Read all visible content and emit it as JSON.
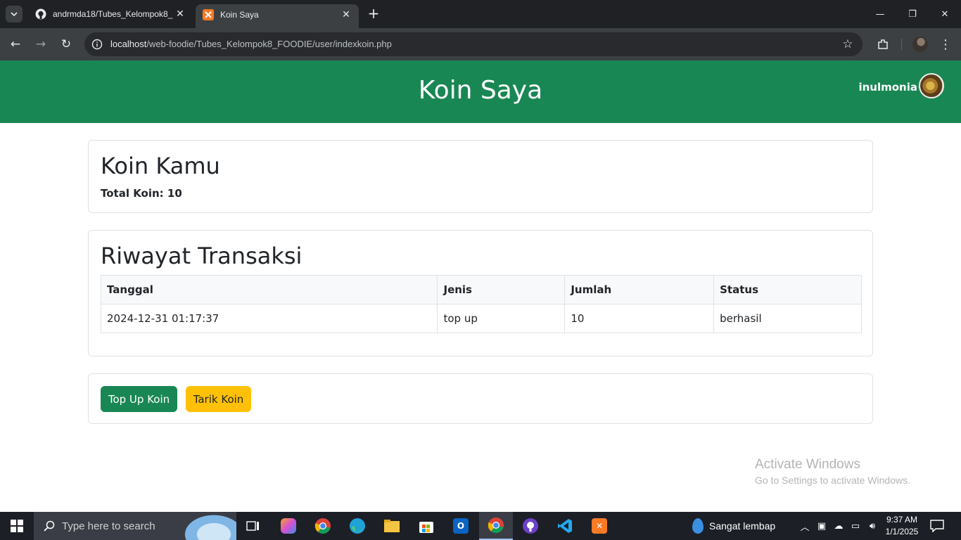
{
  "browser": {
    "tabs": [
      {
        "title": "andrmda18/Tubes_Kelompok8_",
        "icon": "github-icon",
        "active": false
      },
      {
        "title": "Koin Saya",
        "icon": "xampp-icon",
        "active": true
      }
    ],
    "url_host": "localhost",
    "url_path": "/web-foodie/Tubes_Kelompok8_FOODIE/user/indexkoin.php"
  },
  "header": {
    "title": "Koin Saya",
    "username": "inulmonia",
    "color": "#198754"
  },
  "coin_card": {
    "heading": "Koin Kamu",
    "total_label": "Total Koin: 10"
  },
  "history_card": {
    "heading": "Riwayat Transaksi",
    "columns": [
      "Tanggal",
      "Jenis",
      "Jumlah",
      "Status"
    ],
    "rows": [
      {
        "tanggal": "2024-12-31 01:17:37",
        "jenis": "top up",
        "jumlah": "10",
        "status": "berhasil"
      }
    ]
  },
  "actions": {
    "topup_label": "Top Up Koin",
    "tarik_label": "Tarik Koin",
    "topup_color": "#198754",
    "tarik_color": "#ffc107"
  },
  "watermark": {
    "line1": "Activate Windows",
    "line2": "Go to Settings to activate Windows."
  },
  "taskbar": {
    "search_placeholder": "Type here to search",
    "weather": "Sangat lembap",
    "time": "9:37 AM",
    "date": "1/1/2025"
  }
}
